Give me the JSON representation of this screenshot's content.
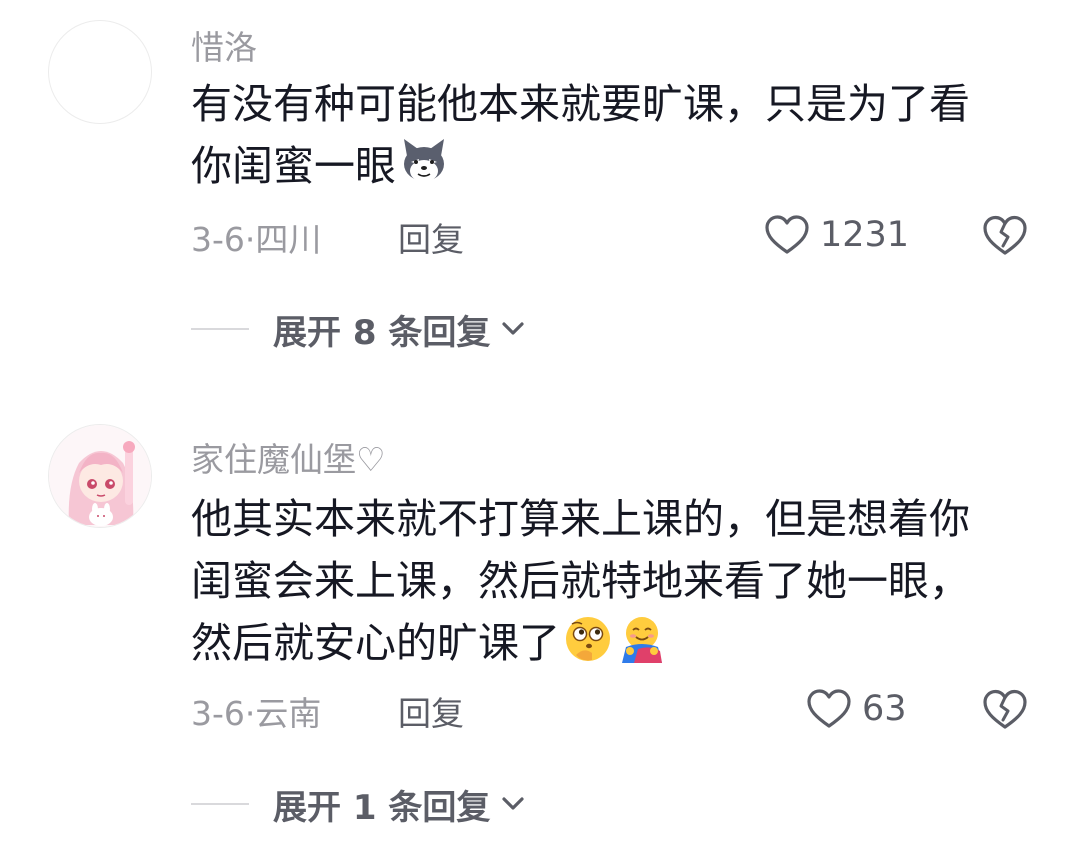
{
  "comments": [
    {
      "username": "惜洛",
      "text_lines": [
        "有没有种可能他本来就要旷课，只是为了看",
        "你闺蜜一眼"
      ],
      "emojis": [
        "husky-emoji"
      ],
      "date_location": "3-6·四川",
      "reply_label": "回复",
      "like_count": "1231",
      "expand_label": "展开 8 条回复"
    },
    {
      "username": "家住魔仙堡♡",
      "text_lines": [
        "他其实本来就不打算来上课的，但是想着你",
        "闺蜜会来上课，然后就特地来看了她一眼，",
        "然后就安心的旷课了"
      ],
      "emojis": [
        "thinking-face-emoji",
        "hug-emoji"
      ],
      "date_location": "3-6·云南",
      "reply_label": "回复",
      "like_count": "63",
      "expand_label": "展开 1 条回复"
    }
  ],
  "icons": {
    "like": "heart-outline-icon",
    "dislike": "broken-heart-icon",
    "expand": "chevron-down-icon"
  },
  "colors": {
    "text_primary": "#161823",
    "text_secondary": "#9a9aa0",
    "text_action": "#5b5d66",
    "divider": "#d9d9dc"
  }
}
